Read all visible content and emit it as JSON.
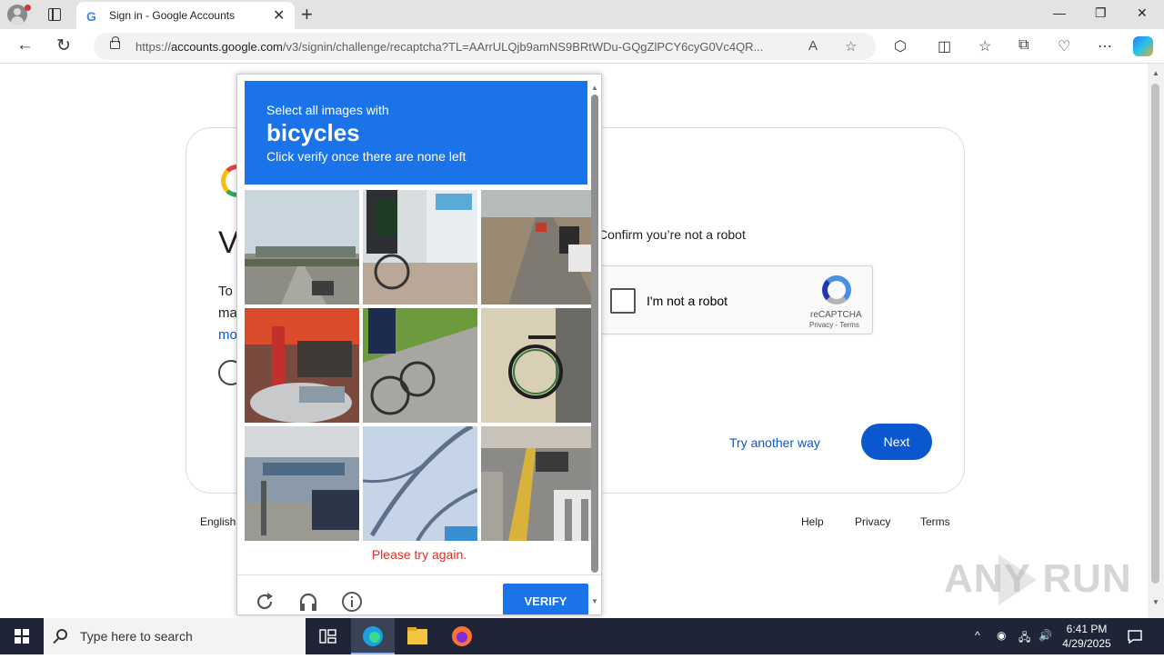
{
  "browser": {
    "tab_title": "Sign in - Google Accounts",
    "tab_favicon": "G",
    "url_prefix": "https://",
    "url_domain": "accounts.google.com",
    "url_rest": "/v3/signin/challenge/recaptcha?TL=AArrULQjb9amNS9BRtWDu-GQgZlPCY6cyG0Vc4QR...",
    "window_buttons": [
      "—",
      "❐",
      "✕"
    ]
  },
  "page": {
    "peek_v": "V",
    "peek_to": "To",
    "peek_ma": "ma",
    "peek_mo": "mo",
    "confirm_text": "Confirm you’re not a robot",
    "recaptcha": {
      "label": "I'm not a robot",
      "brand": "reCAPTCHA",
      "terms": "Privacy - Terms"
    },
    "try_another": "Try another way",
    "next": "Next",
    "footer": {
      "language": "English",
      "help": "Help",
      "privacy": "Privacy",
      "terms": "Terms"
    }
  },
  "challenge": {
    "line1": "Select all images with",
    "target": "bicycles",
    "line3": "Click verify once there are none left",
    "error": "Please try again.",
    "verify": "VERIFY",
    "tiles": [
      "overpass road with car",
      "delivery rider with bicycle",
      "street with parked cars",
      "red bus stop with car",
      "person riding bicycle on grass path",
      "bicycle wheel by wall",
      "building and truck",
      "tree shadows on pavement",
      "street crosswalk with car"
    ]
  },
  "taskbar": {
    "search_placeholder": "Type here to search",
    "time": "6:41 PM",
    "date": "4/29/2025"
  },
  "watermark": "ANY RUN",
  "colors": {
    "google_blue": "#0b57d0",
    "captcha_blue": "#1a73e8",
    "error_red": "#d93025",
    "taskbar": "#1f2536"
  }
}
